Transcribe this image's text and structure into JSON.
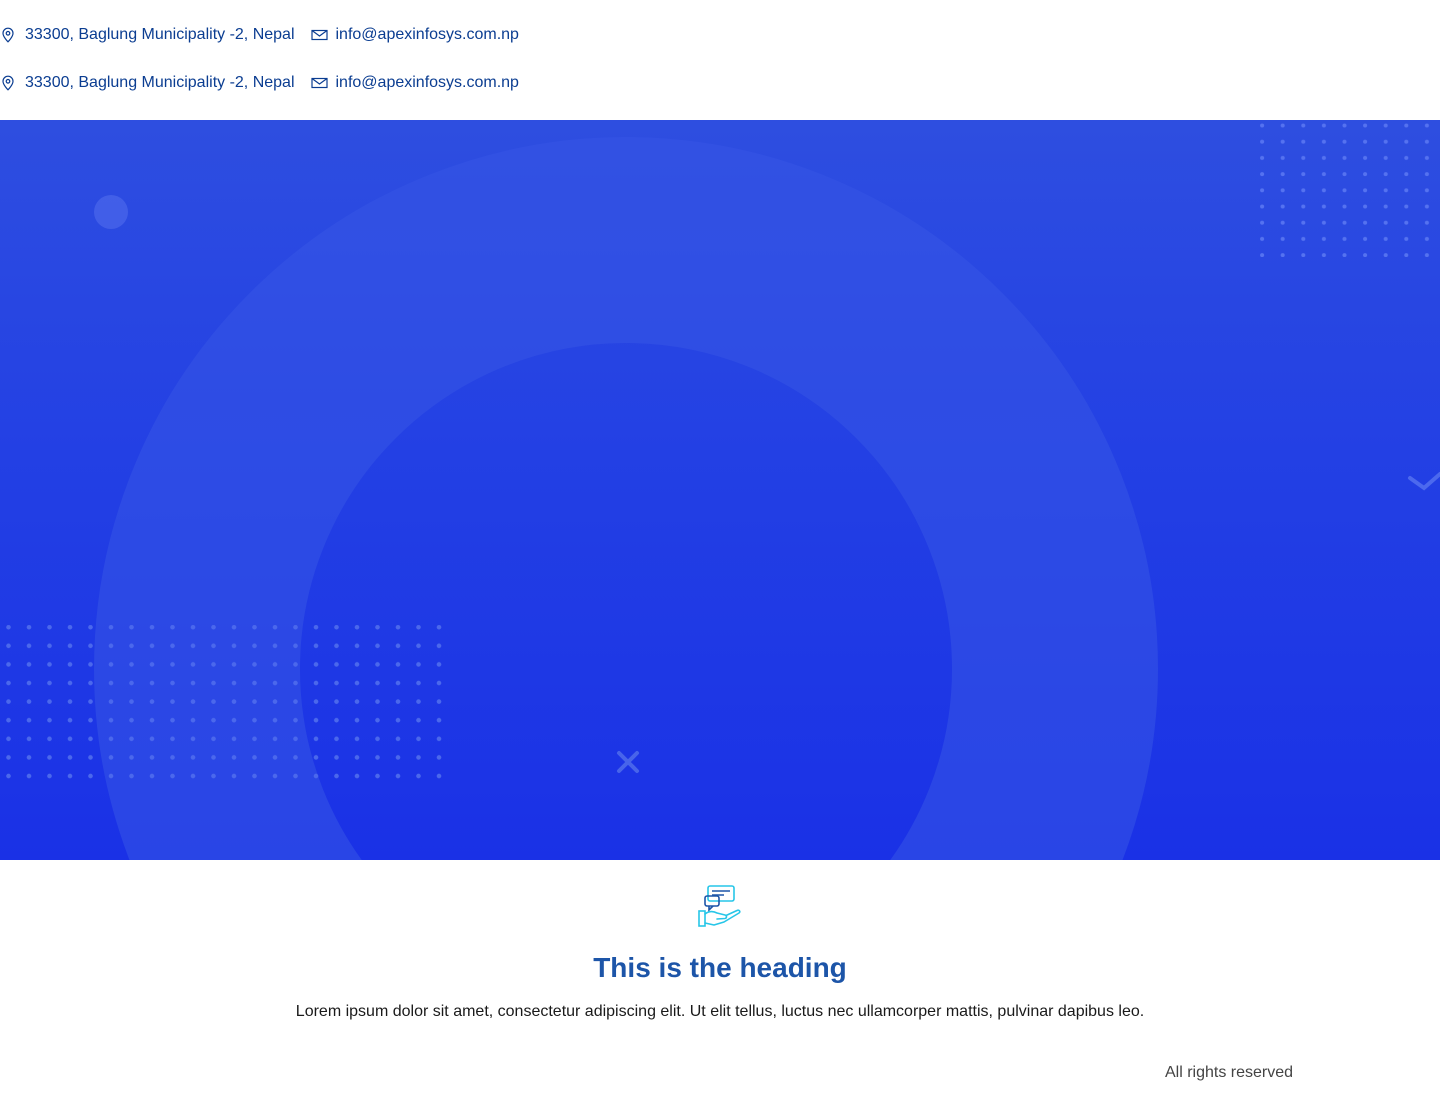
{
  "topbar": {
    "rows": [
      {
        "address": "33300, Baglung Municipality -2, Nepal",
        "email": "info@apexinfosys.com.np"
      },
      {
        "address": "33300, Baglung Municipality -2, Nepal",
        "email": "info@apexinfosys.com.np"
      }
    ],
    "icons": {
      "address": "map-pin-icon",
      "email": "envelope-icon"
    }
  },
  "hero": {
    "colors": {
      "top": "#2e4ee0",
      "bottom": "#1a31e6"
    }
  },
  "feature": {
    "icon": "hand-chat-icon",
    "heading": "This is the heading",
    "text": "Lorem ipsum dolor sit amet, consectetur adipiscing elit. Ut elit tellus, luctus nec ullamcorper mattis, pulvinar dapibus leo."
  },
  "footer": {
    "copyright": "All rights reserved"
  },
  "colors": {
    "link": "#0b3d91",
    "heading": "#1d55a8",
    "icon_accent": "#27c6e8"
  }
}
